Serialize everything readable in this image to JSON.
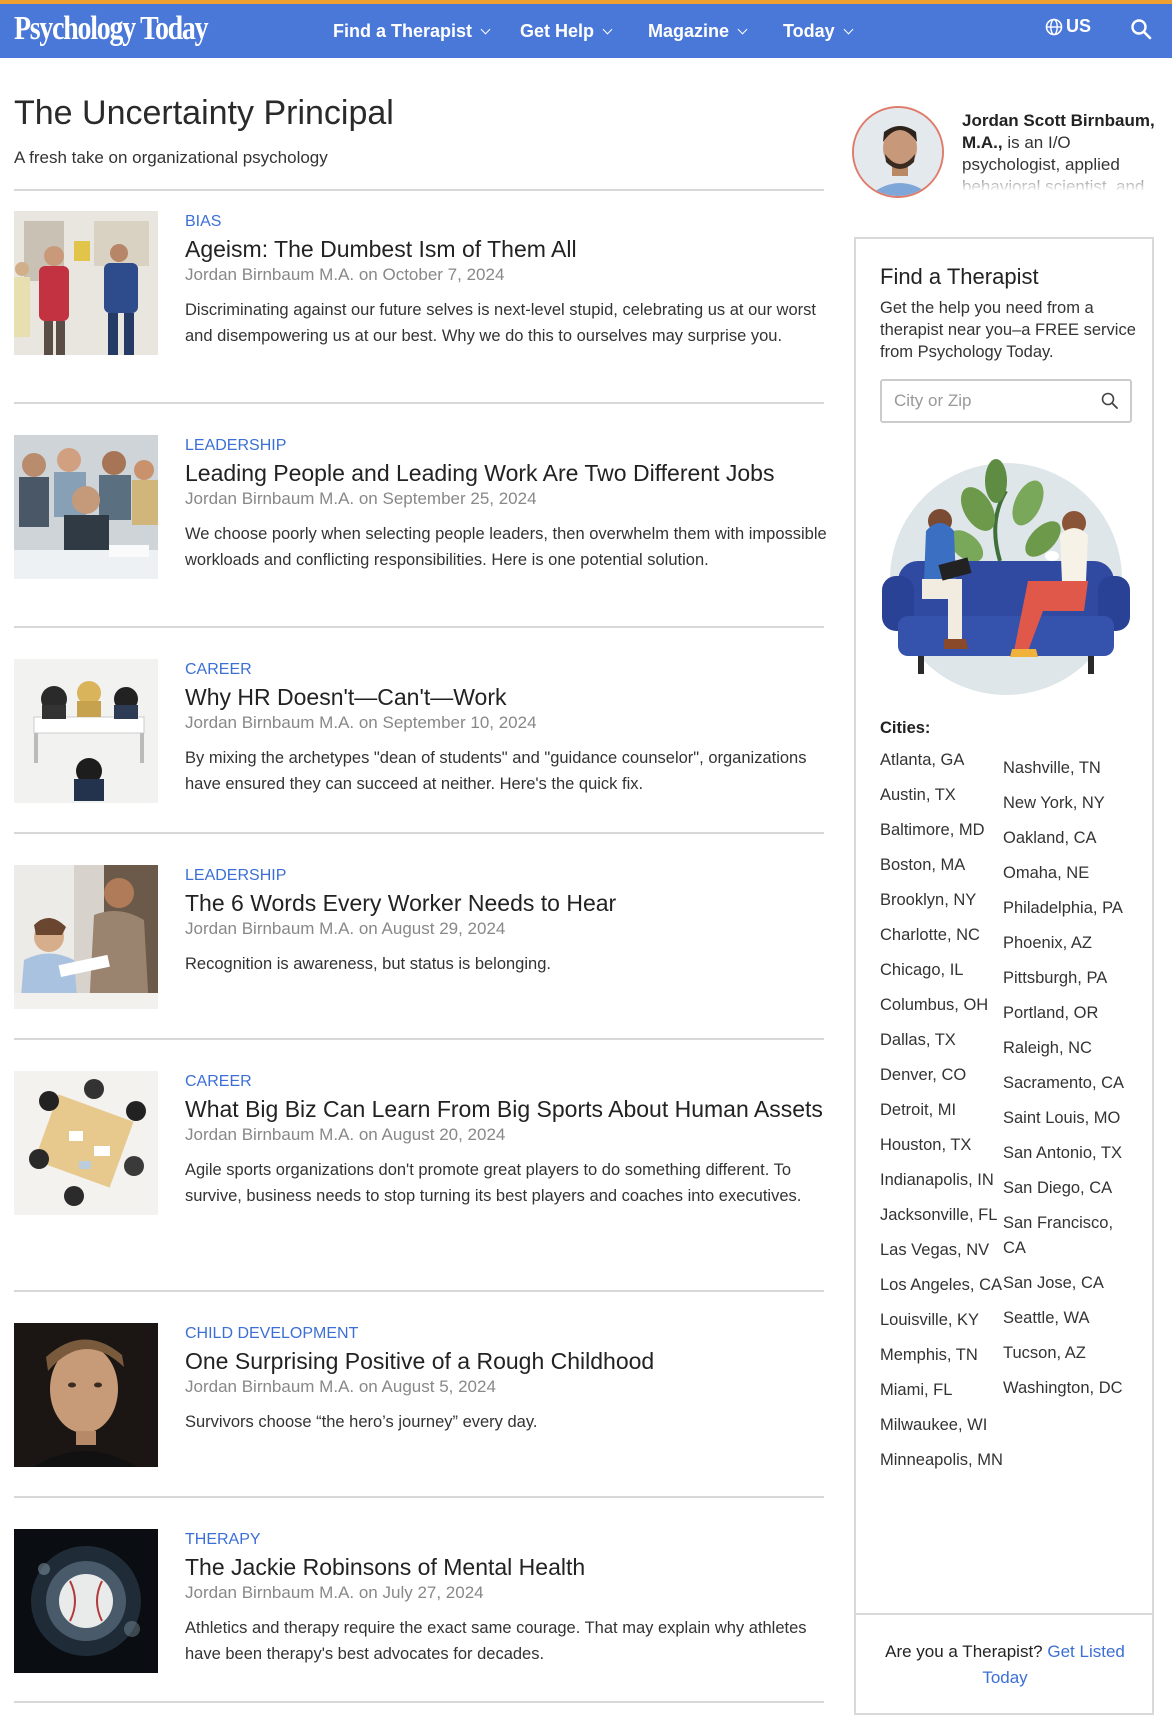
{
  "header": {
    "logo": "Psychology Today",
    "nav": [
      {
        "label": "Find a Therapist"
      },
      {
        "label": "Get Help"
      },
      {
        "label": "Magazine"
      },
      {
        "label": "Today"
      }
    ],
    "region": "US",
    "brand_color": "#4a78d9",
    "accent_color": "#f0a030"
  },
  "blog": {
    "title": "The Uncertainty Principal",
    "subtitle": "A fresh take on organizational psychology"
  },
  "articles": [
    {
      "category": "BIAS",
      "title": "Ageism: The Dumbest Ism of Them All",
      "meta": "Jordan Birnbaum M.A. on October 7, 2024",
      "teaser": "Discriminating against our future selves is next-level stupid, celebrating us at our worst and disempowering us at our best. Why we do this to ourselves may surprise you."
    },
    {
      "category": "LEADERSHIP",
      "title": "Leading People and Leading Work Are Two Different Jobs",
      "meta": "Jordan Birnbaum M.A. on September 25, 2024",
      "teaser": "We choose poorly when selecting people leaders, then overwhelm them with impossible workloads and conflicting responsibilities. Here is one potential solution."
    },
    {
      "category": "CAREER",
      "title": "Why HR Doesn't—Can't—Work",
      "meta": "Jordan Birnbaum M.A. on September 10, 2024",
      "teaser": "By mixing the archetypes \"dean of students\" and \"guidance counselor\", organizations have ensured they can succeed at neither. Here's the quick fix."
    },
    {
      "category": "LEADERSHIP",
      "title": "The 6 Words Every Worker Needs to Hear",
      "meta": "Jordan Birnbaum M.A. on August 29, 2024",
      "teaser": "Recognition is awareness, but status is belonging."
    },
    {
      "category": "CAREER",
      "title": "What Big Biz Can Learn From Big Sports About Human Assets",
      "meta": "Jordan Birnbaum M.A. on August 20, 2024",
      "teaser": "Agile sports organizations don't promote great players to do something different. To survive, business needs to stop turning its best players and coaches into executives."
    },
    {
      "category": "CHILD DEVELOPMENT",
      "title": "One Surprising Positive of a Rough Childhood",
      "meta": "Jordan Birnbaum M.A. on August 5, 2024",
      "teaser": "Survivors choose “the hero’s journey” every day."
    },
    {
      "category": "THERAPY",
      "title": "The Jackie Robinsons of Mental Health",
      "meta": "Jordan Birnbaum M.A. on July 27, 2024",
      "teaser": "Athletics and therapy require the exact same courage. That may explain why athletes have been therapy's best advocates for decades."
    }
  ],
  "author": {
    "name": "Jordan Scott Birnbaum, M.A.,",
    "bio": " is an I/O psychologist, applied behavioral scientist, and"
  },
  "find_therapist": {
    "title": "Find a Therapist",
    "description": "Get the help you need from a therapist near you–a FREE service from Psychology Today.",
    "search_placeholder": "City or Zip",
    "cities_label": "Cities:",
    "cities_left": [
      "Atlanta, GA",
      "Austin, TX",
      "Baltimore, MD",
      "Boston, MA",
      "Brooklyn, NY",
      "Charlotte, NC",
      "Chicago, IL",
      "Columbus, OH",
      "Dallas, TX",
      "Denver, CO",
      "Detroit, MI",
      "Houston, TX",
      "Indianapolis, IN",
      "Jacksonville, FL",
      "Las Vegas, NV",
      "Los Angeles, CA",
      "Louisville, KY",
      "Memphis, TN",
      "Miami, FL",
      "Milwaukee, WI",
      "Minneapolis, MN"
    ],
    "cities_right": [
      "Nashville, TN",
      "New York, NY",
      "Oakland, CA",
      "Omaha, NE",
      "Philadelphia, PA",
      "Phoenix, AZ",
      "Pittsburgh, PA",
      "Portland, OR",
      "Raleigh, NC",
      "Sacramento, CA",
      "Saint Louis, MO",
      "San Antonio, TX",
      "San Diego, CA",
      "San Francisco, CA",
      "San Jose, CA",
      "Seattle, WA",
      "Tucson, AZ",
      "Washington, DC"
    ],
    "footer_text": "Are you a Therapist?",
    "footer_link": "Get Listed Today"
  }
}
